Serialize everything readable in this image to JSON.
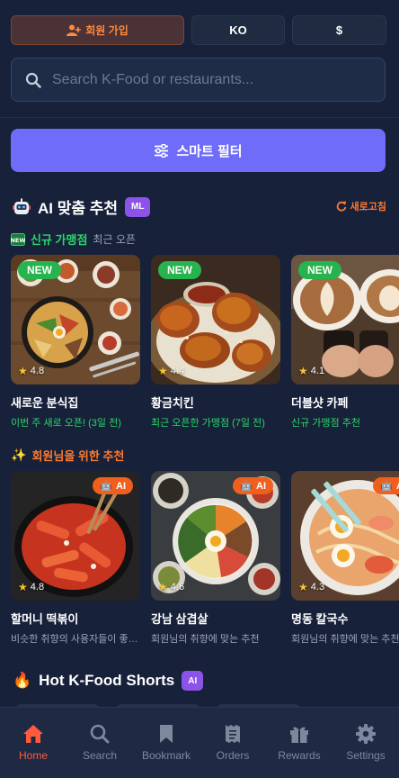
{
  "header": {
    "signup_label": "회원 가입",
    "language_label": "KO",
    "currency_label": "$"
  },
  "search": {
    "placeholder": "Search K-Food or restaurants..."
  },
  "smart_filter": {
    "label": "스마트 필터"
  },
  "ai_section": {
    "title": "AI 맞춤 추천",
    "badge": "ML",
    "refresh_label": "새로고침",
    "new_stores": {
      "badge_icon": "NEW",
      "title": "신규 가맹점",
      "subtitle": "최근 오픈",
      "cards": [
        {
          "badge": "NEW",
          "rating": "4.8",
          "name": "새로운 분식집",
          "sub": "이번 주 새로 오픈! (3일 전)"
        },
        {
          "badge": "NEW",
          "rating": "4.4",
          "name": "황금치킨",
          "sub": "최근 오픈한 가맹점 (7일 전)"
        },
        {
          "badge": "NEW",
          "rating": "4.1",
          "name": "더블샷 카페",
          "sub": "신규 가맹점 추천"
        }
      ]
    },
    "member_picks": {
      "title": "회원님을 위한 추천",
      "cards": [
        {
          "badge": "AI",
          "rating": "4.8",
          "name": "할머니 떡볶이",
          "sub": "비슷한 취향의 사용자들이 좋아해요"
        },
        {
          "badge": "AI",
          "rating": "4.6",
          "name": "강남 삼겹살",
          "sub": "회원님의 취향에 맞는 추천"
        },
        {
          "badge": "AI",
          "rating": "4.3",
          "name": "명동 칼국수",
          "sub": "회원님의 취향에 맞는 추천"
        }
      ]
    }
  },
  "shorts_section": {
    "title": "Hot K-Food Shorts",
    "badge": "AI"
  },
  "bottom_nav": {
    "items": [
      {
        "label": "Home",
        "icon": "home-icon",
        "active": true
      },
      {
        "label": "Search",
        "icon": "search-icon",
        "active": false
      },
      {
        "label": "Bookmark",
        "icon": "bookmark-icon",
        "active": false
      },
      {
        "label": "Orders",
        "icon": "receipt-icon",
        "active": false
      },
      {
        "label": "Rewards",
        "icon": "gift-icon",
        "active": false
      },
      {
        "label": "Settings",
        "icon": "gear-icon",
        "active": false
      }
    ]
  },
  "colors": {
    "background": "#17213a",
    "accent_orange": "#ff5b3c",
    "filter_purple": "#6e6cf8",
    "new_green": "#27b34e"
  }
}
